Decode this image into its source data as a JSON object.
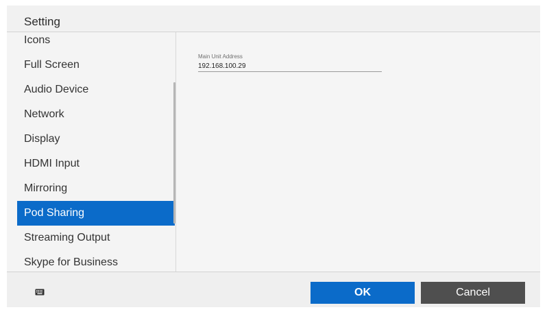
{
  "window": {
    "title": "Setting"
  },
  "sidebar": {
    "items": [
      {
        "label": "Icons",
        "selected": false
      },
      {
        "label": "Full Screen",
        "selected": false
      },
      {
        "label": "Audio Device",
        "selected": false
      },
      {
        "label": "Network",
        "selected": false
      },
      {
        "label": "Display",
        "selected": false
      },
      {
        "label": "HDMI Input",
        "selected": false
      },
      {
        "label": "Mirroring",
        "selected": false
      },
      {
        "label": "Pod Sharing",
        "selected": true
      },
      {
        "label": "Streaming Output",
        "selected": false
      },
      {
        "label": "Skype for Business",
        "selected": false
      }
    ]
  },
  "main": {
    "main_unit_address": {
      "label": "Main Unit Address",
      "value": "192.168.100.29"
    }
  },
  "footer": {
    "keyboard_icon": "keyboard-icon",
    "ok_label": "OK",
    "cancel_label": "Cancel"
  },
  "colors": {
    "accent": "#0b6bc9",
    "cancel_button": "#4f4f4f",
    "background": "#efefef"
  }
}
